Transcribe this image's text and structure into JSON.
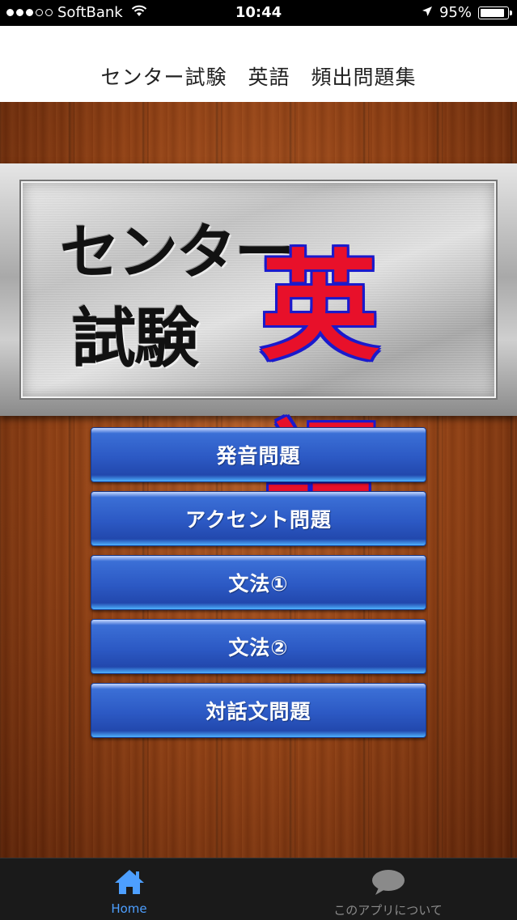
{
  "status_bar": {
    "carrier": "SoftBank",
    "time": "10:44",
    "battery_percent": "95%",
    "battery_level": 0.95,
    "signal_filled": 3,
    "signal_total": 5
  },
  "nav": {
    "title": "センター試験　英語　頻出問題集"
  },
  "sign": {
    "line1": "センター",
    "line2": "試験",
    "subject": "英語"
  },
  "menu": {
    "items": [
      {
        "label": "発音問題"
      },
      {
        "label": "アクセント問題"
      },
      {
        "label": "文法①"
      },
      {
        "label": "文法②"
      },
      {
        "label": "対話文問題"
      }
    ]
  },
  "tab_bar": {
    "tabs": [
      {
        "label": "Home",
        "icon": "home-icon",
        "active": true
      },
      {
        "label": "このアプリについて",
        "icon": "speech-bubble-icon",
        "active": false
      }
    ]
  },
  "colors": {
    "tab_active": "#4d9fff",
    "tab_inactive": "#8a8a8a",
    "button_blue": "#2c59c4",
    "subject_red": "#e8102a",
    "subject_outline": "#1a1acc"
  }
}
